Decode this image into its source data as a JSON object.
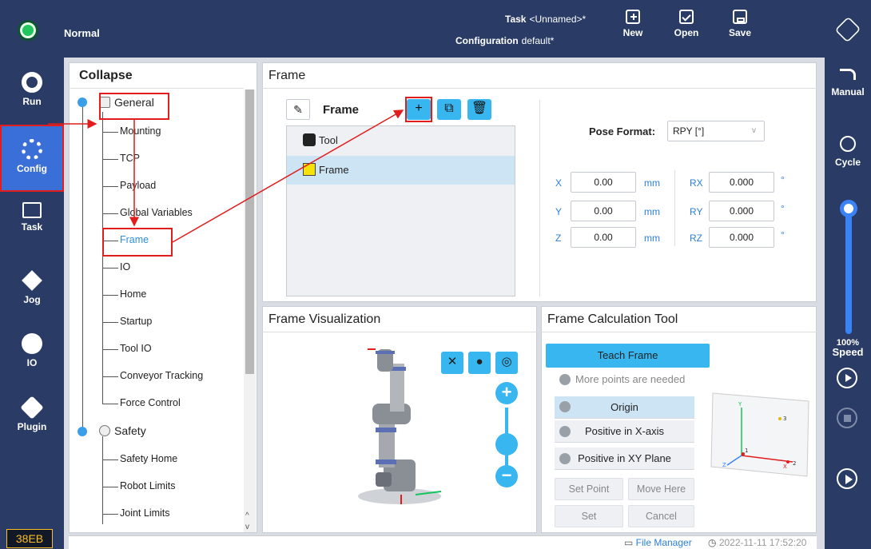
{
  "header": {
    "mode": "Normal",
    "task_label": "Task",
    "task_value": "<Unnamed>*",
    "config_label": "Configuration",
    "config_value": "default*",
    "buttons": {
      "new": "New",
      "open": "Open",
      "save": "Save"
    },
    "status_color": "#22c55e"
  },
  "leftnav": {
    "items": [
      {
        "label": "Run",
        "icon": "run-icon"
      },
      {
        "label": "Config",
        "icon": "gear-icon"
      },
      {
        "label": "Task",
        "icon": "code-icon"
      },
      {
        "label": "Jog",
        "icon": "move-icon"
      },
      {
        "label": "IO",
        "icon": "io-icon"
      },
      {
        "label": "Plugin",
        "icon": "cube-icon"
      }
    ],
    "badge": "38EB"
  },
  "rightnav": {
    "manual": "Manual",
    "cycle": "Cycle",
    "speed_value": "100%",
    "speed_label": "Speed",
    "speed_fraction": 1.0
  },
  "tree": {
    "header": "Collapse",
    "general": "General",
    "general_items": [
      "Mounting",
      "TCP",
      "Payload",
      "Global Variables",
      "Frame",
      "IO",
      "Home",
      "Startup",
      "Tool IO",
      "Conveyor Tracking",
      "Force Control"
    ],
    "safety": "Safety",
    "safety_items": [
      "Safety Home",
      "Robot Limits",
      "Joint Limits"
    ]
  },
  "frame": {
    "title": "Frame",
    "name": "Frame",
    "list": [
      "Tool",
      "Frame"
    ],
    "pose_format_label": "Pose Format:",
    "pose_format_value": "RPY [°]",
    "pose": {
      "x_label": "X",
      "x": "0.00",
      "y_label": "Y",
      "y": "0.00",
      "z_label": "Z",
      "z": "0.00",
      "rx_label": "RX",
      "rx": "0.000",
      "ry_label": "RY",
      "ry": "0.000",
      "rz_label": "RZ",
      "rz": "0.000",
      "lin_unit": "mm",
      "ang_unit": "°"
    }
  },
  "vis": {
    "title": "Frame Visualization"
  },
  "calc": {
    "title": "Frame Calculation Tool",
    "teach": "Teach Frame",
    "note": "More points are needed",
    "points": [
      "Origin",
      "Positive in X-axis",
      "Positive in XY Plane"
    ],
    "set_point": "Set Point",
    "move_here": "Move Here",
    "set": "Set",
    "cancel": "Cancel",
    "diagram_labels": {
      "x": "X",
      "y": "Y",
      "z": "Z",
      "p1": "1",
      "p2": "2",
      "p3": "3"
    }
  },
  "footer": {
    "file_manager": "File Manager",
    "datetime": "2022-11-11 17:52:20"
  }
}
